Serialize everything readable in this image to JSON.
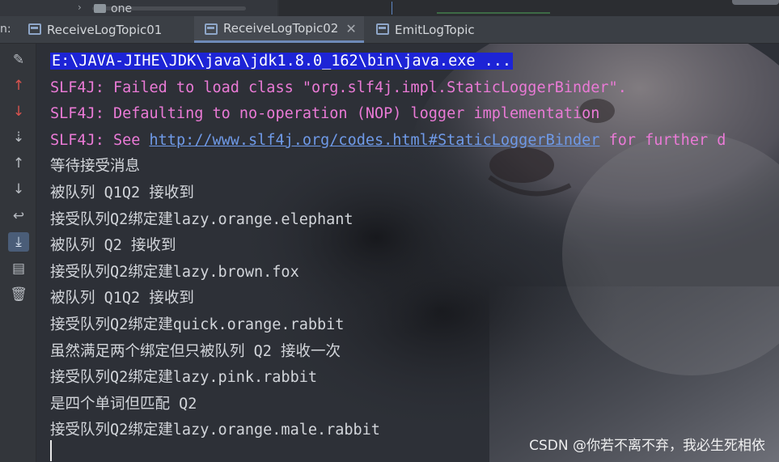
{
  "project_tree": {
    "folder_label": "one"
  },
  "run_window": {
    "label": "n:",
    "tabs": [
      {
        "label": "ReceiveLogTopic01",
        "active": false,
        "closable": false
      },
      {
        "label": "ReceiveLogTopic02",
        "active": true,
        "closable": true
      },
      {
        "label": "EmitLogTopic",
        "active": false,
        "closable": false
      }
    ]
  },
  "toolbar": {
    "buttons": [
      {
        "icon": "wrench-icon",
        "color": "#b8bcc2"
      },
      {
        "icon": "arrow-up-red-icon",
        "color": "#d9534f"
      },
      {
        "icon": "arrow-down-red-icon",
        "color": "#d9534f"
      },
      {
        "icon": "sort-down-icon"
      },
      {
        "icon": "arrow-up-icon"
      },
      {
        "icon": "arrow-down-icon"
      },
      {
        "icon": "soft-wrap-icon"
      },
      {
        "icon": "scroll-to-end-icon",
        "highlighted": true
      },
      {
        "icon": "print-icon"
      },
      {
        "icon": "trash-icon"
      }
    ]
  },
  "console": {
    "command_line": "E:\\JAVA-JIHE\\JDK\\java\\jdk1.8.0_162\\bin\\java.exe ...",
    "warn1": "SLF4J: Failed to load class \"org.slf4j.impl.StaticLoggerBinder\".",
    "warn2": "SLF4J: Defaulting to no-operation (NOP) logger implementation",
    "warn3_prefix": "SLF4J: See ",
    "warn3_link": "http://www.slf4j.org/codes.html#StaticLoggerBinder",
    "warn3_suffix": " for further d",
    "output": [
      "等待接受消息",
      "被队列 Q1Q2 接收到",
      "接受队列Q2绑定建lazy.orange.elephant",
      "被队列 Q2 接收到",
      "接受队列Q2绑定建lazy.brown.fox",
      "被队列 Q1Q2 接收到",
      "接受队列Q2绑定建quick.orange.rabbit",
      "虽然满足两个绑定但只被队列 Q2 接收一次",
      "接受队列Q2绑定建lazy.pink.rabbit",
      "是四个单词但匹配 Q2",
      "接受队列Q2绑定建lazy.orange.male.rabbit"
    ]
  },
  "watermark": "CSDN @你若不离不弃，我必生死相依",
  "colors": {
    "command_highlight": "#1d24d6",
    "warning_text": "#ea7ad6",
    "link_text": "#6f9ae8",
    "console_text": "#d2d5da"
  }
}
